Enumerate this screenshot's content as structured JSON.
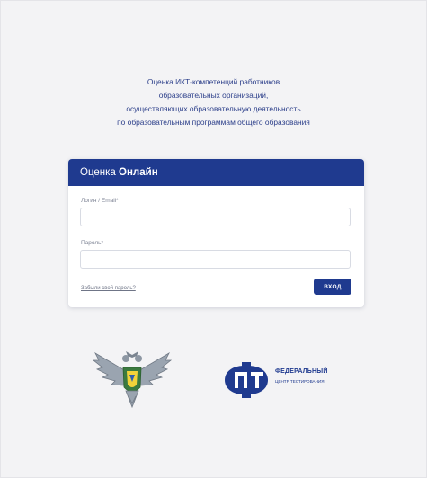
{
  "heading": {
    "line1": "Оценка ИКТ-компетенций работников",
    "line2": "образовательных организаций,",
    "line3": "осуществляющих образовательную деятельность",
    "line4": "по образовательным программам общего образования"
  },
  "card": {
    "title_regular": "Оценка ",
    "title_bold": "Онлайн",
    "login_label": "Логин / Email*",
    "login_value": "",
    "password_label": "Пароль*",
    "password_value": "",
    "forgot_link": "Забыли свой пароль?",
    "login_button": "ВХОД"
  },
  "logos": {
    "right_logo_line1": "ФЕДЕРАЛЬНЫЙ",
    "right_logo_line2": "ЦЕНТР ТЕСТИРОВАНИЯ",
    "brand_color": "#1f3a8f",
    "emblem_icon": "rosobrnadzor-eagle-emblem-icon",
    "right_logo_icon": "fct-monogram-icon"
  }
}
